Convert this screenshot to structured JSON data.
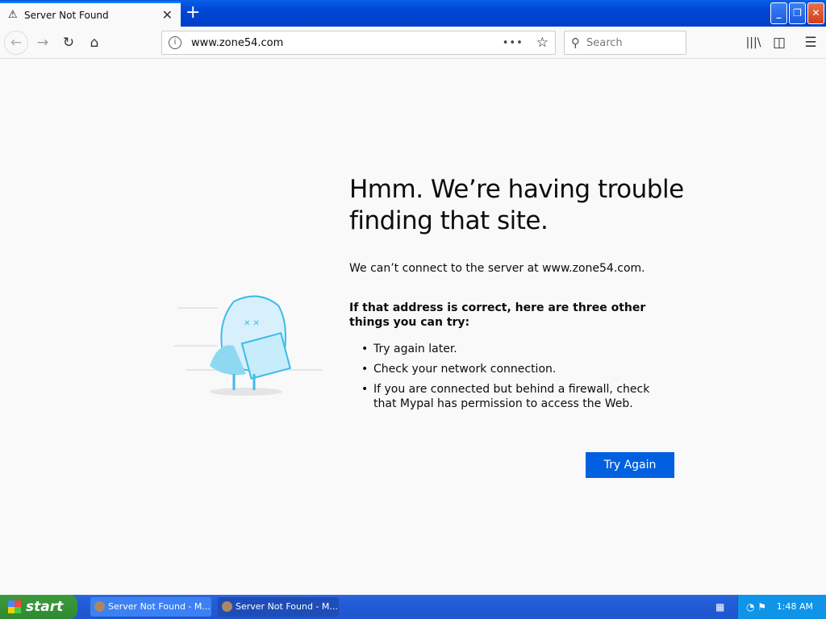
{
  "tab": {
    "title": "Server Not Found",
    "icon": "warning-icon"
  },
  "toolbar": {
    "url": "www.zone54.com",
    "search_placeholder": "Search"
  },
  "error": {
    "title": "Hmm. We’re having trouble finding that site.",
    "message": "We can’t connect to the server at www.zone54.com.",
    "suggest_heading": "If that address is correct, here are three other things you can try:",
    "suggestions": [
      "Try again later.",
      "Check your network connection.",
      "If you are connected but behind a firewall, check that Mypal has permission to access the Web."
    ],
    "button": "Try Again",
    "button_color": "#0060df"
  },
  "taskbar": {
    "start": "start",
    "tasks": [
      "Server Not Found - M...",
      "Server Not Found - M..."
    ],
    "clock": "1:48 AM"
  }
}
